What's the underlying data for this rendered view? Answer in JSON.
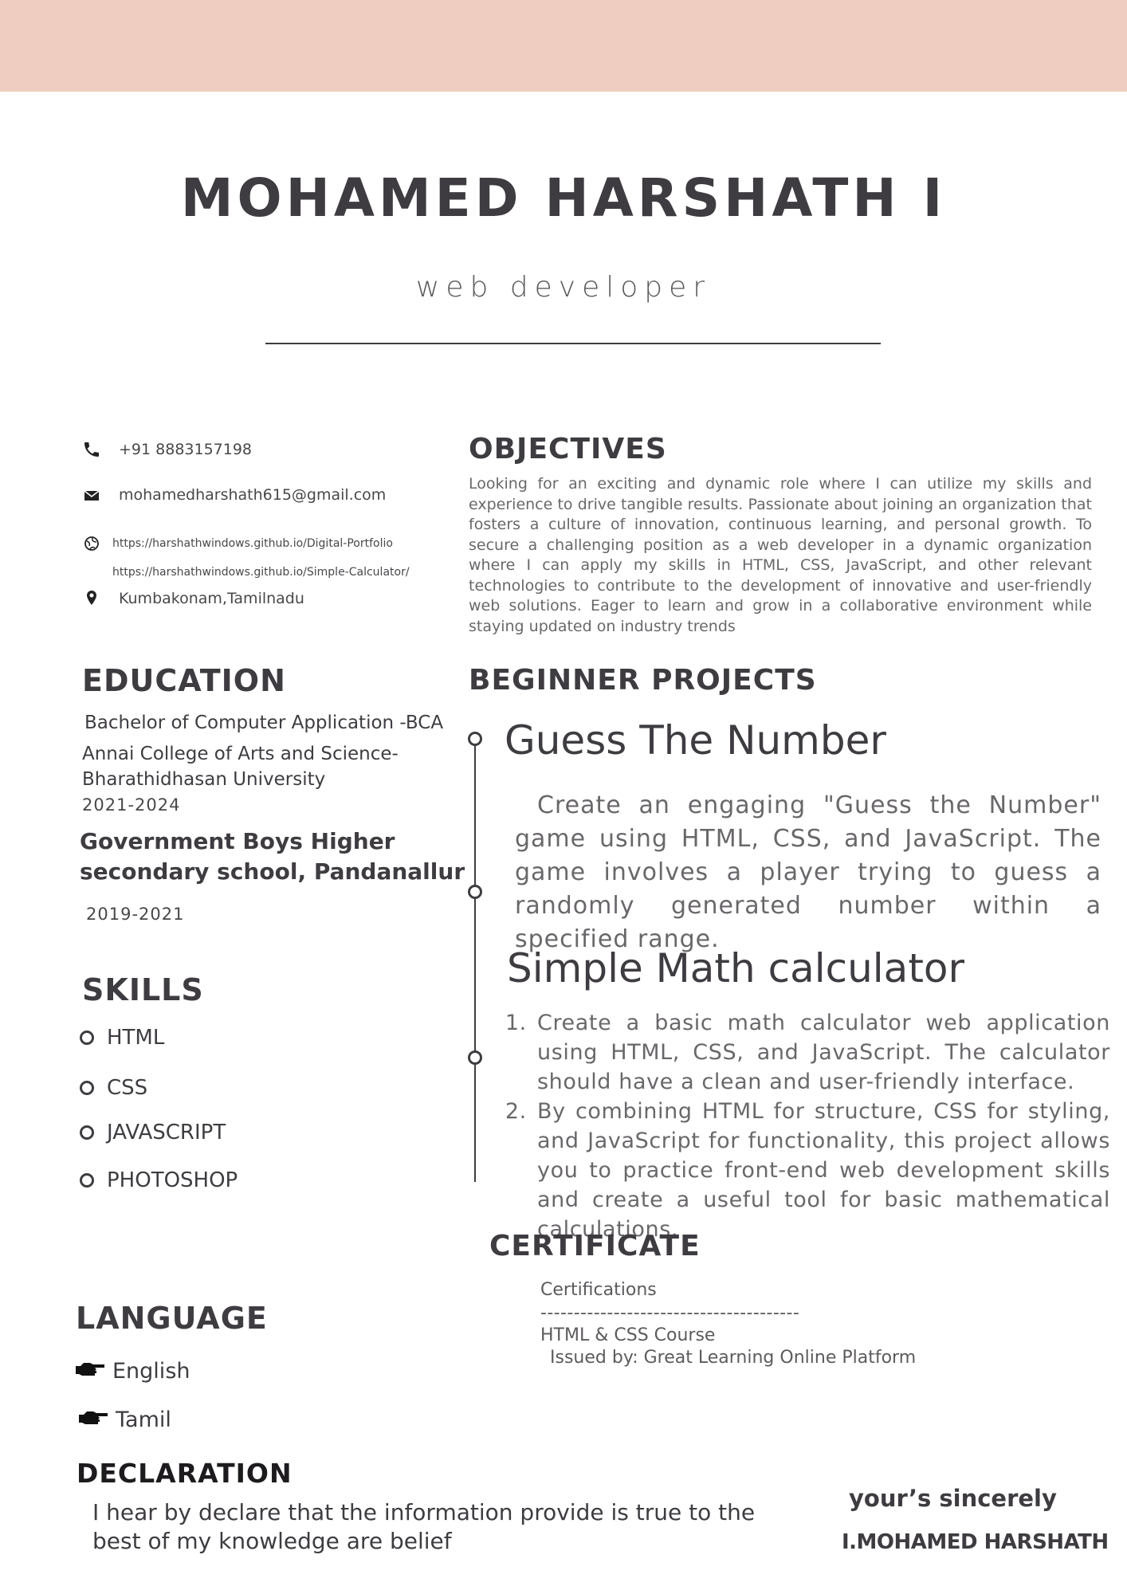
{
  "header": {
    "name": "MOHAMED HARSHATH I",
    "role": "web developer"
  },
  "contact": {
    "phone": "+91 8883157198",
    "email": "mohamedharshath615@gmail.com",
    "link1": "https://harshathwindows.github.io/Digital-Portfolio",
    "link2": "https://harshathwindows.github.io/Simple-Calculator/",
    "location": "Kumbakonam,Tamilnadu",
    "icons": [
      "phone-icon",
      "mail-icon",
      "globe-icon",
      "location-pin-icon"
    ]
  },
  "education": {
    "heading": "EDUCATION",
    "degree": "Bachelor of Computer Application -BCA",
    "college_line1": "Annai College of Arts and Science-",
    "college_line2": "Bharathidhasan University",
    "college_years": "2021-2024",
    "school_line1": "Government Boys Higher",
    "school_line2": "secondary school, Pandanallur",
    "school_years": "2019-2021"
  },
  "skills": {
    "heading": "SKILLS",
    "items": [
      "HTML",
      "CSS",
      "JAVASCRIPT",
      "PHOTOSHOP"
    ]
  },
  "language": {
    "heading": "LANGUAGE",
    "items": [
      "English",
      "Tamil"
    ],
    "icon": "pointing-hand-icon"
  },
  "declaration": {
    "heading": "DECLARATION",
    "line1": "I hear by declare that the information provide is true to the",
    "line2": "best of my knowledge are belief"
  },
  "signature": {
    "closing": "your’s sincerely",
    "name": "I.MOHAMED HARSHATH"
  },
  "objectives": {
    "heading": "OBJECTIVES",
    "text": "Looking for an exciting and dynamic role where I can utilize my skills and experience to drive tangible results. Passionate about joining an organization that fosters a culture of innovation, continuous learning, and personal growth. To secure a challenging position as a web developer in a dynamic organization where I can apply my skills in HTML, CSS, JavaScript, and other relevant technologies to contribute to the development of innovative and user-friendly web solutions. Eager to learn and grow in a collaborative environment while staying updated on industry trends"
  },
  "projects": {
    "heading": "BEGINNER PROJECTS",
    "p1_title": "Guess The Number",
    "p1_text": "Create an engaging \"Guess the Number\" game using HTML, CSS, and JavaScript. The game involves a player trying to guess a randomly generated number within a specified range.",
    "p2_title": "Simple Math calculator",
    "p2_items": [
      "Create a basic math calculator web application using HTML, CSS, and JavaScript. The calculator should have a clean and user-friendly interface.",
      "By combining HTML for structure, CSS for styling, and JavaScript for functionality, this project allows you to practice front-end web development skills and create a useful tool for basic mathematical calculations."
    ]
  },
  "certificate": {
    "heading": "CERTIFICATE",
    "label": "Certifications",
    "divider": "---------------------------------------",
    "course": "HTML & CSS Course",
    "issuer": "Issued by: Great Learning Online Platform"
  },
  "colors": {
    "top_band": "#efcdc1",
    "text_dark": "#3f3c41",
    "text_muted": "#6a676b"
  }
}
